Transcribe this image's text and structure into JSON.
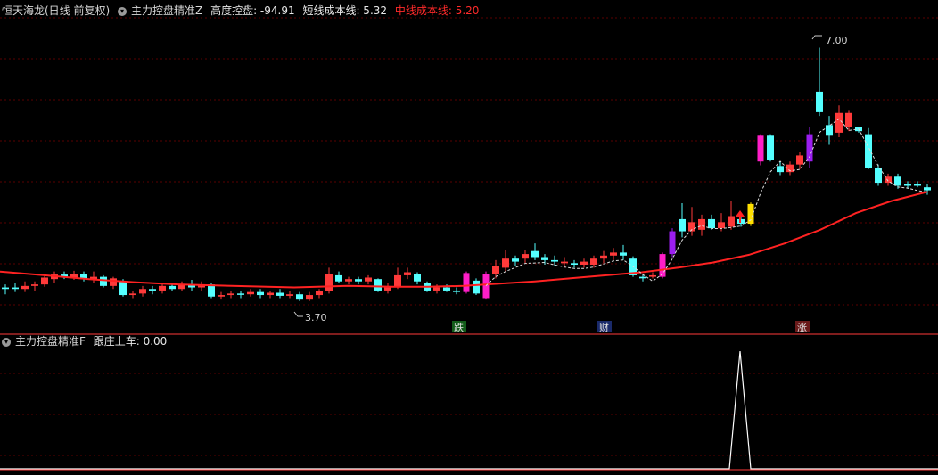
{
  "colors": {
    "background": "#000000",
    "up": "#ff3a3a",
    "down": "#54ffff",
    "ma": "#ff2222",
    "grid": "#5a0000",
    "text": "#d8d8d8",
    "magenta": "#ff1ec8",
    "purple": "#9b1ef0",
    "yellow": "#ffe000",
    "spike": "#ffffff"
  },
  "header": {
    "stock": "恒天海龙(日线 前复权)",
    "indicator": "主力控盘精准Z",
    "height_label": "高度控盘: -94.91",
    "short_line": "短线成本线: 5.32",
    "mid_line": "中线成本线: 5.20"
  },
  "sub_header": {
    "indicator": "主力控盘精准F",
    "value": "跟庄上车: 0.00"
  },
  "annotations": {
    "high_label": "7.00",
    "low_label": "3.70",
    "tags": [
      "跌",
      "财",
      "涨"
    ]
  },
  "chart_data": {
    "type": "candlestick",
    "ylim": [
      3.4,
      7.3
    ],
    "grid": true,
    "candles": [
      [
        3.82,
        3.84,
        3.75,
        3.88,
        "down"
      ],
      [
        3.84,
        3.82,
        3.78,
        3.9,
        "down"
      ],
      [
        3.82,
        3.86,
        3.78,
        3.92,
        "up"
      ],
      [
        3.86,
        3.88,
        3.8,
        3.92,
        "up"
      ],
      [
        3.88,
        3.97,
        3.85,
        4.0,
        "up"
      ],
      [
        3.95,
        4.01,
        3.9,
        4.05,
        "up"
      ],
      [
        4.01,
        3.97,
        3.95,
        4.05,
        "down"
      ],
      [
        3.97,
        4.02,
        3.94,
        4.06,
        "up"
      ],
      [
        4.02,
        3.95,
        3.92,
        4.05,
        "down"
      ],
      [
        3.95,
        3.98,
        3.9,
        4.05,
        "up"
      ],
      [
        3.98,
        3.86,
        3.84,
        4.0,
        "down"
      ],
      [
        3.86,
        3.96,
        3.82,
        3.98,
        "up"
      ],
      [
        3.92,
        3.74,
        3.72,
        3.95,
        "down"
      ],
      [
        3.74,
        3.76,
        3.7,
        3.8,
        "up"
      ],
      [
        3.76,
        3.82,
        3.72,
        3.86,
        "up"
      ],
      [
        3.82,
        3.8,
        3.75,
        3.86,
        "down"
      ],
      [
        3.8,
        3.86,
        3.76,
        3.9,
        "up"
      ],
      [
        3.86,
        3.82,
        3.8,
        3.9,
        "down"
      ],
      [
        3.82,
        3.88,
        3.8,
        3.92,
        "up"
      ],
      [
        3.88,
        3.84,
        3.8,
        3.94,
        "down"
      ],
      [
        3.84,
        3.88,
        3.8,
        3.92,
        "up"
      ],
      [
        3.88,
        3.72,
        3.7,
        3.9,
        "down"
      ],
      [
        3.72,
        3.74,
        3.68,
        3.78,
        "up"
      ],
      [
        3.74,
        3.76,
        3.7,
        3.8,
        "up"
      ],
      [
        3.76,
        3.75,
        3.7,
        3.8,
        "down"
      ],
      [
        3.75,
        3.78,
        3.72,
        3.82,
        "up"
      ],
      [
        3.78,
        3.74,
        3.7,
        3.82,
        "down"
      ],
      [
        3.74,
        3.77,
        3.7,
        3.8,
        "up"
      ],
      [
        3.77,
        3.73,
        3.7,
        3.82,
        "down"
      ],
      [
        3.73,
        3.75,
        3.7,
        3.8,
        "up"
      ],
      [
        3.75,
        3.68,
        3.66,
        3.78,
        "down"
      ],
      [
        3.68,
        3.74,
        3.66,
        3.78,
        "up"
      ],
      [
        3.74,
        3.79,
        3.7,
        3.82,
        "up"
      ],
      [
        3.79,
        4.02,
        3.76,
        4.1,
        "up"
      ],
      [
        4.0,
        3.92,
        3.9,
        4.05,
        "down"
      ],
      [
        3.92,
        3.95,
        3.88,
        3.98,
        "up"
      ],
      [
        3.95,
        3.92,
        3.88,
        3.98,
        "down"
      ],
      [
        3.92,
        3.97,
        3.88,
        4.0,
        "up"
      ],
      [
        3.95,
        3.8,
        3.78,
        3.96,
        "down"
      ],
      [
        3.8,
        3.84,
        3.76,
        3.9,
        "up"
      ],
      [
        3.84,
        4.0,
        3.82,
        4.1,
        "up"
      ],
      [
        4.0,
        4.04,
        3.95,
        4.1,
        "up"
      ],
      [
        4.02,
        3.92,
        3.88,
        4.04,
        "down"
      ],
      [
        3.9,
        3.8,
        3.78,
        3.92,
        "down"
      ],
      [
        3.8,
        3.84,
        3.76,
        3.88,
        "up"
      ],
      [
        3.84,
        3.8,
        3.78,
        3.88,
        "down"
      ],
      [
        3.8,
        3.78,
        3.75,
        3.84,
        "down"
      ],
      [
        3.78,
        4.03,
        3.76,
        4.05,
        "magenta"
      ],
      [
        3.93,
        3.76,
        3.74,
        3.96,
        "down"
      ],
      [
        3.7,
        4.02,
        3.68,
        4.05,
        "magenta"
      ],
      [
        4.02,
        4.12,
        3.96,
        4.2,
        "up"
      ],
      [
        4.1,
        4.22,
        4.05,
        4.34,
        "up"
      ],
      [
        4.22,
        4.18,
        4.12,
        4.26,
        "down"
      ],
      [
        4.22,
        4.28,
        4.16,
        4.34,
        "up"
      ],
      [
        4.32,
        4.24,
        4.2,
        4.42,
        "down"
      ],
      [
        4.24,
        4.2,
        4.14,
        4.28,
        "down"
      ],
      [
        4.2,
        4.18,
        4.12,
        4.26,
        "down"
      ],
      [
        4.18,
        4.16,
        4.1,
        4.24,
        "up"
      ],
      [
        4.16,
        4.14,
        4.1,
        4.2,
        "down"
      ],
      [
        4.14,
        4.18,
        4.1,
        4.22,
        "up"
      ],
      [
        4.14,
        4.22,
        4.1,
        4.26,
        "up"
      ],
      [
        4.22,
        4.26,
        4.16,
        4.32,
        "up"
      ],
      [
        4.26,
        4.3,
        4.2,
        4.36,
        "up"
      ],
      [
        4.3,
        4.26,
        4.2,
        4.4,
        "down"
      ],
      [
        4.22,
        4.0,
        3.98,
        4.25,
        "down"
      ],
      [
        3.96,
        3.98,
        3.92,
        4.02,
        "down"
      ],
      [
        3.98,
        4.0,
        3.96,
        4.04,
        "up"
      ],
      [
        3.98,
        4.28,
        3.96,
        4.3,
        "magenta"
      ],
      [
        4.28,
        4.58,
        4.24,
        4.62,
        "purple"
      ],
      [
        4.58,
        4.74,
        4.5,
        4.95,
        "down"
      ],
      [
        4.58,
        4.7,
        4.52,
        4.9,
        "up"
      ],
      [
        4.6,
        4.74,
        4.52,
        4.8,
        "up"
      ],
      [
        4.74,
        4.62,
        4.6,
        4.8,
        "down"
      ],
      [
        4.62,
        4.7,
        4.58,
        4.82,
        "up"
      ],
      [
        4.64,
        4.78,
        4.6,
        4.98,
        "up"
      ],
      [
        4.74,
        4.68,
        4.64,
        4.8,
        "down"
      ],
      [
        4.68,
        4.94,
        4.65,
        4.96,
        "yellow"
      ],
      [
        5.5,
        5.84,
        5.45,
        5.86,
        "magenta"
      ],
      [
        5.84,
        5.52,
        5.5,
        5.86,
        "down"
      ],
      [
        5.44,
        5.36,
        5.32,
        5.5,
        "down"
      ],
      [
        5.36,
        5.46,
        5.32,
        5.5,
        "up"
      ],
      [
        5.46,
        5.58,
        5.4,
        5.62,
        "up"
      ],
      [
        5.5,
        5.86,
        5.42,
        5.96,
        "purple"
      ],
      [
        6.15,
        6.42,
        6.1,
        7.0,
        "down"
      ],
      [
        5.98,
        5.84,
        5.72,
        6.1,
        "down"
      ],
      [
        5.88,
        6.14,
        5.82,
        6.24,
        "up"
      ],
      [
        6.14,
        5.96,
        5.9,
        6.18,
        "up"
      ],
      [
        5.96,
        5.9,
        5.88,
        5.96,
        "down"
      ],
      [
        5.86,
        5.42,
        5.4,
        5.94,
        "down"
      ],
      [
        5.42,
        5.22,
        5.18,
        5.46,
        "down"
      ],
      [
        5.22,
        5.3,
        5.18,
        5.34,
        "up"
      ],
      [
        5.3,
        5.18,
        5.14,
        5.34,
        "down"
      ],
      [
        5.2,
        5.18,
        5.14,
        5.24,
        "down"
      ],
      [
        5.18,
        5.2,
        5.16,
        5.24,
        "down"
      ],
      [
        5.16,
        5.12,
        5.06,
        5.2,
        "down"
      ]
    ],
    "ma_line": [
      [
        0,
        4.05
      ],
      [
        50,
        4.0
      ],
      [
        100,
        3.95
      ],
      [
        150,
        3.91
      ],
      [
        200,
        3.88
      ],
      [
        260,
        3.86
      ],
      [
        330,
        3.84
      ],
      [
        390,
        3.86
      ],
      [
        440,
        3.85
      ],
      [
        480,
        3.85
      ],
      [
        520,
        3.86
      ],
      [
        560,
        3.89
      ],
      [
        600,
        3.92
      ],
      [
        640,
        3.96
      ],
      [
        680,
        4.0
      ],
      [
        720,
        4.04
      ],
      [
        760,
        4.1
      ],
      [
        800,
        4.17
      ],
      [
        840,
        4.27
      ],
      [
        880,
        4.42
      ],
      [
        920,
        4.6
      ],
      [
        960,
        4.82
      ],
      [
        1000,
        4.98
      ],
      [
        1040,
        5.1
      ]
    ]
  }
}
